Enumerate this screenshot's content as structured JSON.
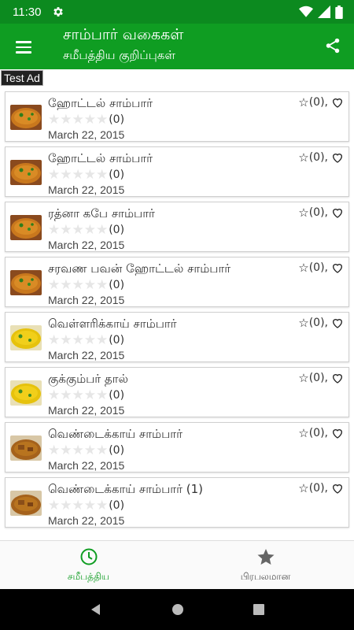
{
  "status": {
    "time": "11:30"
  },
  "app_bar": {
    "title": "சாம்பார் வகைகள்",
    "subtitle": "சமீபத்திய குறிப்புகள்"
  },
  "ad": {
    "label": "Test Ad"
  },
  "recipes": [
    {
      "title": "ஹோட்டல் சாம்பார்",
      "rating_count": "(0)",
      "date": "March 22, 2015",
      "fav": "(0),",
      "thumb": "sambar"
    },
    {
      "title": "ஹோட்டல்  சாம்பார்",
      "rating_count": "(0)",
      "date": "March 22, 2015",
      "fav": "(0),",
      "thumb": "sambar"
    },
    {
      "title": "ரத்னா கபே சாம்பார்",
      "rating_count": "(0)",
      "date": "March 22, 2015",
      "fav": "(0),",
      "thumb": "sambar"
    },
    {
      "title": "சரவண பவன் ஹோட்டல் சாம்பார்",
      "rating_count": "(0)",
      "date": "March 22, 2015",
      "fav": "(0),",
      "thumb": "sambar"
    },
    {
      "title": "வெள்ளரிக்காய் சாம்பார்",
      "rating_count": "(0)",
      "date": "March 22, 2015",
      "fav": "(0),",
      "thumb": "yellow"
    },
    {
      "title": "குக்கும்பர் தால்",
      "rating_count": "(0)",
      "date": "March 22, 2015",
      "fav": "(0),",
      "thumb": "yellow"
    },
    {
      "title": "வெண்டைக்காய் சாம்பார்",
      "rating_count": "(0)",
      "date": "March 22, 2015",
      "fav": "(0),",
      "thumb": "brown"
    },
    {
      "title": "வெண்டைக்காய் சாம்பார் (1)",
      "rating_count": "(0)",
      "date": "March 22, 2015",
      "fav": "(0),",
      "thumb": "brown"
    }
  ],
  "bottom_nav": {
    "recent_label": "சமீபத்திய",
    "popular_label": "பிரபலமான"
  },
  "colors": {
    "primary": "#0f9d22",
    "status_bar": "#0c8a1f"
  }
}
